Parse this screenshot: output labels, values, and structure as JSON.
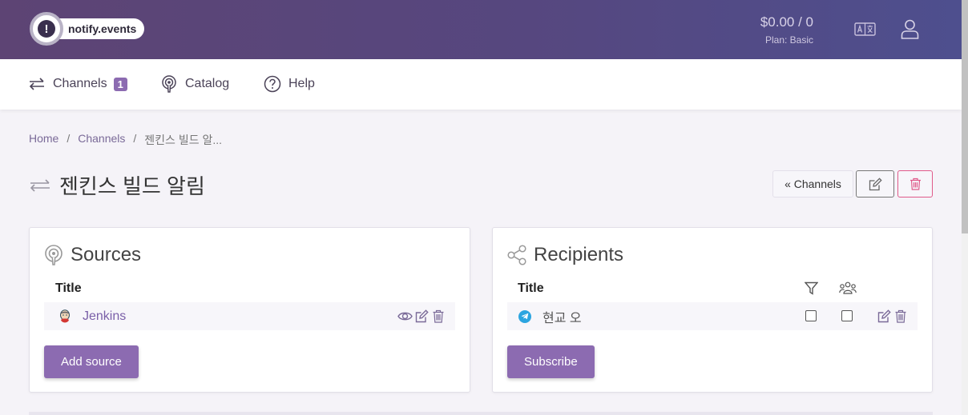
{
  "header": {
    "logo_text": "notify.events",
    "balance": "$0.00 / 0",
    "plan": "Plan: Basic"
  },
  "nav": {
    "channels_label": "Channels",
    "channels_count": "1",
    "catalog_label": "Catalog",
    "help_label": "Help"
  },
  "breadcrumb": {
    "home": "Home",
    "channels": "Channels",
    "current": "젠킨스 빌드 알..."
  },
  "page": {
    "title": "젠킨스 빌드 알림",
    "back_button": "« Channels"
  },
  "sources": {
    "heading": "Sources",
    "col_title": "Title",
    "items": [
      {
        "name": "Jenkins",
        "icon": "jenkins-icon"
      }
    ],
    "add_button": "Add source"
  },
  "recipients": {
    "heading": "Recipients",
    "col_title": "Title",
    "items": [
      {
        "name": "현교 오",
        "icon": "telegram-icon"
      }
    ],
    "subscribe_button": "Subscribe"
  },
  "colors": {
    "accent": "#8c6bb1",
    "header_start": "#5d4474",
    "header_end": "#4e4f8e",
    "danger": "#e05a8a"
  }
}
